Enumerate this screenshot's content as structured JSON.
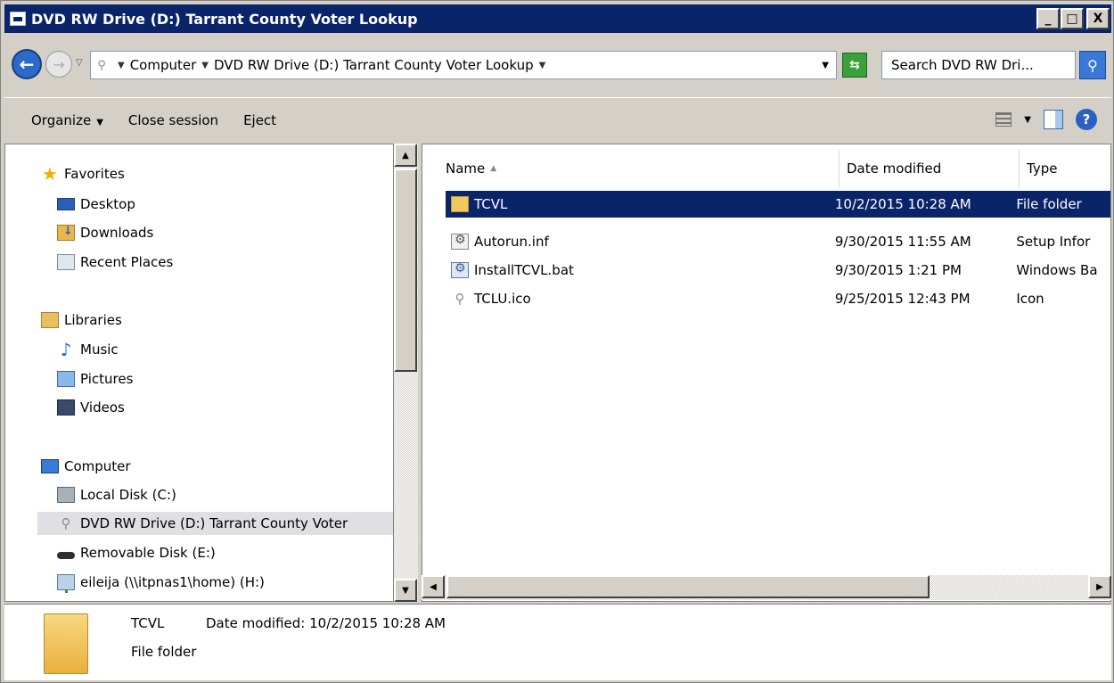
{
  "window": {
    "title": "DVD RW Drive (D:) Tarrant County Voter Lookup",
    "buttons": {
      "minimize": "_",
      "maximize": "□",
      "close": "X"
    }
  },
  "address": {
    "crumbs": [
      "Computer",
      "DVD RW Drive (D:) Tarrant County Voter Lookup"
    ],
    "search_placeholder": "Search DVD RW Dri..."
  },
  "toolbar": {
    "organize": "Organize",
    "close_session": "Close session",
    "eject": "Eject"
  },
  "nav": {
    "favorites": "Favorites",
    "desktop": "Desktop",
    "downloads": "Downloads",
    "recent_places": "Recent Places",
    "libraries": "Libraries",
    "music": "Music",
    "pictures": "Pictures",
    "videos": "Videos",
    "computer": "Computer",
    "local_disk": "Local Disk (C:)",
    "dvd_drive": "DVD RW Drive (D:) Tarrant County Voter",
    "removable": "Removable Disk (E:)",
    "network_drive": "eileija (\\\\itpnas1\\home) (H:)"
  },
  "columns": {
    "name": "Name",
    "date_modified": "Date modified",
    "type": "Type"
  },
  "files": [
    {
      "name": "TCVL",
      "date": "10/2/2015 10:28 AM",
      "type": "File folder",
      "icon": "folder-icon"
    },
    {
      "name": "Autorun.inf",
      "date": "9/30/2015 11:55 AM",
      "type": "Setup Infor",
      "icon": "settings-file-icon"
    },
    {
      "name": "InstallTCVL.bat",
      "date": "9/30/2015 1:21 PM",
      "type": "Windows Ba",
      "icon": "batch-file-icon"
    },
    {
      "name": "TCLU.ico",
      "date": "9/25/2015 12:43 PM",
      "type": "Icon",
      "icon": "magnifier-icon"
    }
  ],
  "details": {
    "name": "TCVL",
    "date_label": "Date modified: 10/2/2015 10:28 AM",
    "type": "File folder"
  },
  "colors": {
    "selection": "#0a246a",
    "title_bar": "#0a246a",
    "chrome": "#d4d0c8"
  }
}
